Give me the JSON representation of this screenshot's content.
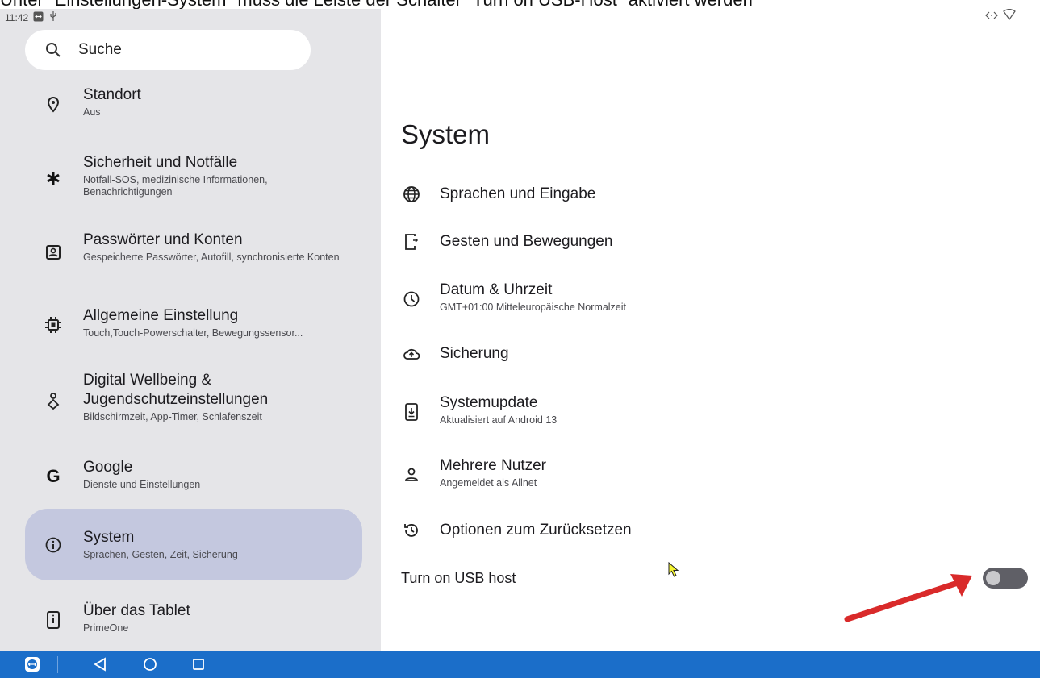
{
  "top_caption": "Unter \"Einstellungen-System\" muss die Leiste der Schalter \"Turn on USB-Host\" aktiviert werden",
  "status_bar": {
    "time": "11:42",
    "icons": [
      "teamviewer-icon",
      "usb-icon",
      "nearby-icon",
      "wifi-icon"
    ]
  },
  "search": {
    "placeholder": "Suche"
  },
  "sidebar": {
    "items": [
      {
        "title": "Standort",
        "subtitle": "Aus",
        "icon": "location-icon"
      },
      {
        "title": "Sicherheit und Notfälle",
        "subtitle": "Notfall-SOS, medizinische Informationen, Benachrichtigungen",
        "icon": "asterisk-icon"
      },
      {
        "title": "Passwörter und Konten",
        "subtitle": "Gespeicherte Passwörter, Autofill, synchronisierte Konten",
        "icon": "account-box-icon"
      },
      {
        "title": "Allgemeine Einstellung",
        "subtitle": "Touch,Touch-Powerschalter, Bewegungssensor...",
        "icon": "chip-icon"
      },
      {
        "title": "Digital Wellbeing & Jugendschutzeinstellungen",
        "subtitle": "Bildschirmzeit, App-Timer, Schlafenszeit",
        "icon": "wellbeing-icon"
      },
      {
        "title": "Google",
        "subtitle": "Dienste und Einstellungen",
        "icon": "google-icon"
      },
      {
        "title": "System",
        "subtitle": "Sprachen, Gesten, Zeit, Sicherung",
        "icon": "info-icon",
        "selected": true
      },
      {
        "title": "Über das Tablet",
        "subtitle": "PrimeOne",
        "icon": "tablet-icon"
      }
    ]
  },
  "main": {
    "title": "System",
    "items": [
      {
        "title": "Sprachen und Eingabe",
        "subtitle": "",
        "icon": "globe-icon"
      },
      {
        "title": "Gesten und Bewegungen",
        "subtitle": "",
        "icon": "gesture-phone-icon"
      },
      {
        "title": "Datum & Uhrzeit",
        "subtitle": "GMT+01:00 Mitteleuropäische Normalzeit",
        "icon": "clock-icon"
      },
      {
        "title": "Sicherung",
        "subtitle": "",
        "icon": "cloud-upload-icon"
      },
      {
        "title": "Systemupdate",
        "subtitle": "Aktualisiert auf Android 13",
        "icon": "system-update-icon"
      },
      {
        "title": "Mehrere Nutzer",
        "subtitle": "Angemeldet als Allnet",
        "icon": "person-icon"
      },
      {
        "title": "Optionen zum Zurücksetzen",
        "subtitle": "",
        "icon": "history-icon"
      }
    ],
    "usb_host_label": "Turn on USB host",
    "usb_host_enabled": false
  },
  "navbar": {
    "buttons": [
      "teamviewer-icon",
      "back-icon",
      "home-icon",
      "recents-icon"
    ]
  },
  "colors": {
    "sidebar_bg": "#e5e5e8",
    "selected_bg": "#c4c8df",
    "navbar_bg": "#1b6ec9",
    "annotation_arrow": "#d92a2a"
  }
}
